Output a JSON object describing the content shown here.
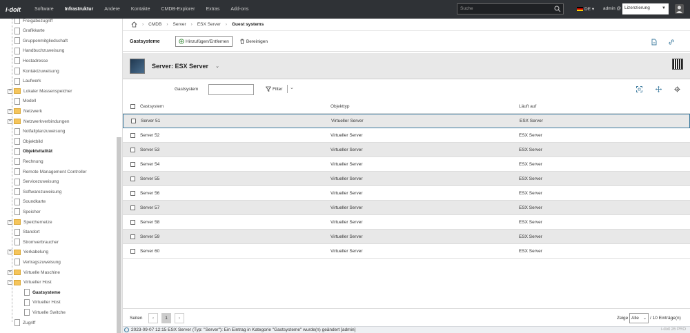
{
  "topbar": {
    "logo": "i-doit",
    "nav": [
      "Software",
      "Infrastruktur",
      "Andere",
      "Kontakte",
      "CMDB-Explorer",
      "Extras",
      "Add-ons"
    ],
    "active_nav": "Infrastruktur",
    "search_placeholder": "Suche",
    "language": "DE",
    "user": "admin @",
    "tenant": "Lizenzierung"
  },
  "sidebar": {
    "items": [
      {
        "label": "Freigabezugriff",
        "type": "file"
      },
      {
        "label": "Grafikkarte",
        "type": "file"
      },
      {
        "label": "Gruppenmitgliedschaft",
        "type": "file"
      },
      {
        "label": "Handbuchzuweisung",
        "type": "file"
      },
      {
        "label": "Hostadresse",
        "type": "file"
      },
      {
        "label": "Kontaktzuweisung",
        "type": "file"
      },
      {
        "label": "Laufwerk",
        "type": "file"
      },
      {
        "label": "Lokaler Massenspeicher",
        "type": "folder"
      },
      {
        "label": "Modell",
        "type": "file"
      },
      {
        "label": "Netzwerk",
        "type": "folder"
      },
      {
        "label": "Netzwerkverbindungen",
        "type": "folder"
      },
      {
        "label": "Notfallplanzuweisung",
        "type": "file"
      },
      {
        "label": "Objektbild",
        "type": "file"
      },
      {
        "label": "Objektvitalität",
        "type": "file",
        "bold": true
      },
      {
        "label": "Rechnung",
        "type": "file"
      },
      {
        "label": "Remote Management Controller",
        "type": "file"
      },
      {
        "label": "Servicezuweisung",
        "type": "file"
      },
      {
        "label": "Softwarezuweisung",
        "type": "file"
      },
      {
        "label": "Soundkarte",
        "type": "file"
      },
      {
        "label": "Speicher",
        "type": "file"
      },
      {
        "label": "Speichernetze",
        "type": "folder"
      },
      {
        "label": "Standort",
        "type": "file"
      },
      {
        "label": "Stromverbraucher",
        "type": "file"
      },
      {
        "label": "Verkabelung",
        "type": "folder"
      },
      {
        "label": "Vertragszuweisung",
        "type": "file"
      },
      {
        "label": "Virtuelle Maschine",
        "type": "folder"
      },
      {
        "label": "Virtueller Host",
        "type": "folder-open"
      },
      {
        "label": "Gastsysteme",
        "type": "subfile",
        "bold": true
      },
      {
        "label": "Virtueller Host",
        "type": "subfile"
      },
      {
        "label": "Virtuelle Switche",
        "type": "subfile"
      },
      {
        "label": "Zugriff",
        "type": "file"
      }
    ]
  },
  "breadcrumb": [
    "CMDB",
    "Server",
    "ESX Server",
    "Guest systems"
  ],
  "category": {
    "title": "Gastsysteme",
    "add_remove": "Hinzufügen/Entfernen",
    "clean": "Bereinigen"
  },
  "object": {
    "title": "Server: ESX Server"
  },
  "filter": {
    "label": "Gastsystem",
    "button": "Filter"
  },
  "table": {
    "headers": [
      "Gastsystem",
      "Objekttyp",
      "Läuft auf"
    ],
    "rows": [
      [
        "Server 51",
        "Virtueller Server",
        "ESX Server"
      ],
      [
        "Server 52",
        "Virtueller Server",
        "ESX Server"
      ],
      [
        "Server 53",
        "Virtueller Server",
        "ESX Server"
      ],
      [
        "Server 54",
        "Virtueller Server",
        "ESX Server"
      ],
      [
        "Server 55",
        "Virtueller Server",
        "ESX Server"
      ],
      [
        "Server 56",
        "Virtueller Server",
        "ESX Server"
      ],
      [
        "Server 57",
        "Virtueller Server",
        "ESX Server"
      ],
      [
        "Server 58",
        "Virtueller Server",
        "ESX Server"
      ],
      [
        "Server 59",
        "Virtueller Server",
        "ESX Server"
      ],
      [
        "Server 60",
        "Virtueller Server",
        "ESX Server"
      ]
    ]
  },
  "footer": {
    "pages_label": "Seiten",
    "current_page": "1",
    "show_label": "Zeige",
    "show_value": "Alle",
    "entries": "/ 10 Einträge(n)"
  },
  "status": {
    "message": "2023-09-07 12:15 ESX Server (Typ: \"Server\"): Ein Eintrag in Kategorie \"Gastsysteme\" wurde(n) geändert [admin]",
    "version": "i-doit 26 PRO"
  }
}
